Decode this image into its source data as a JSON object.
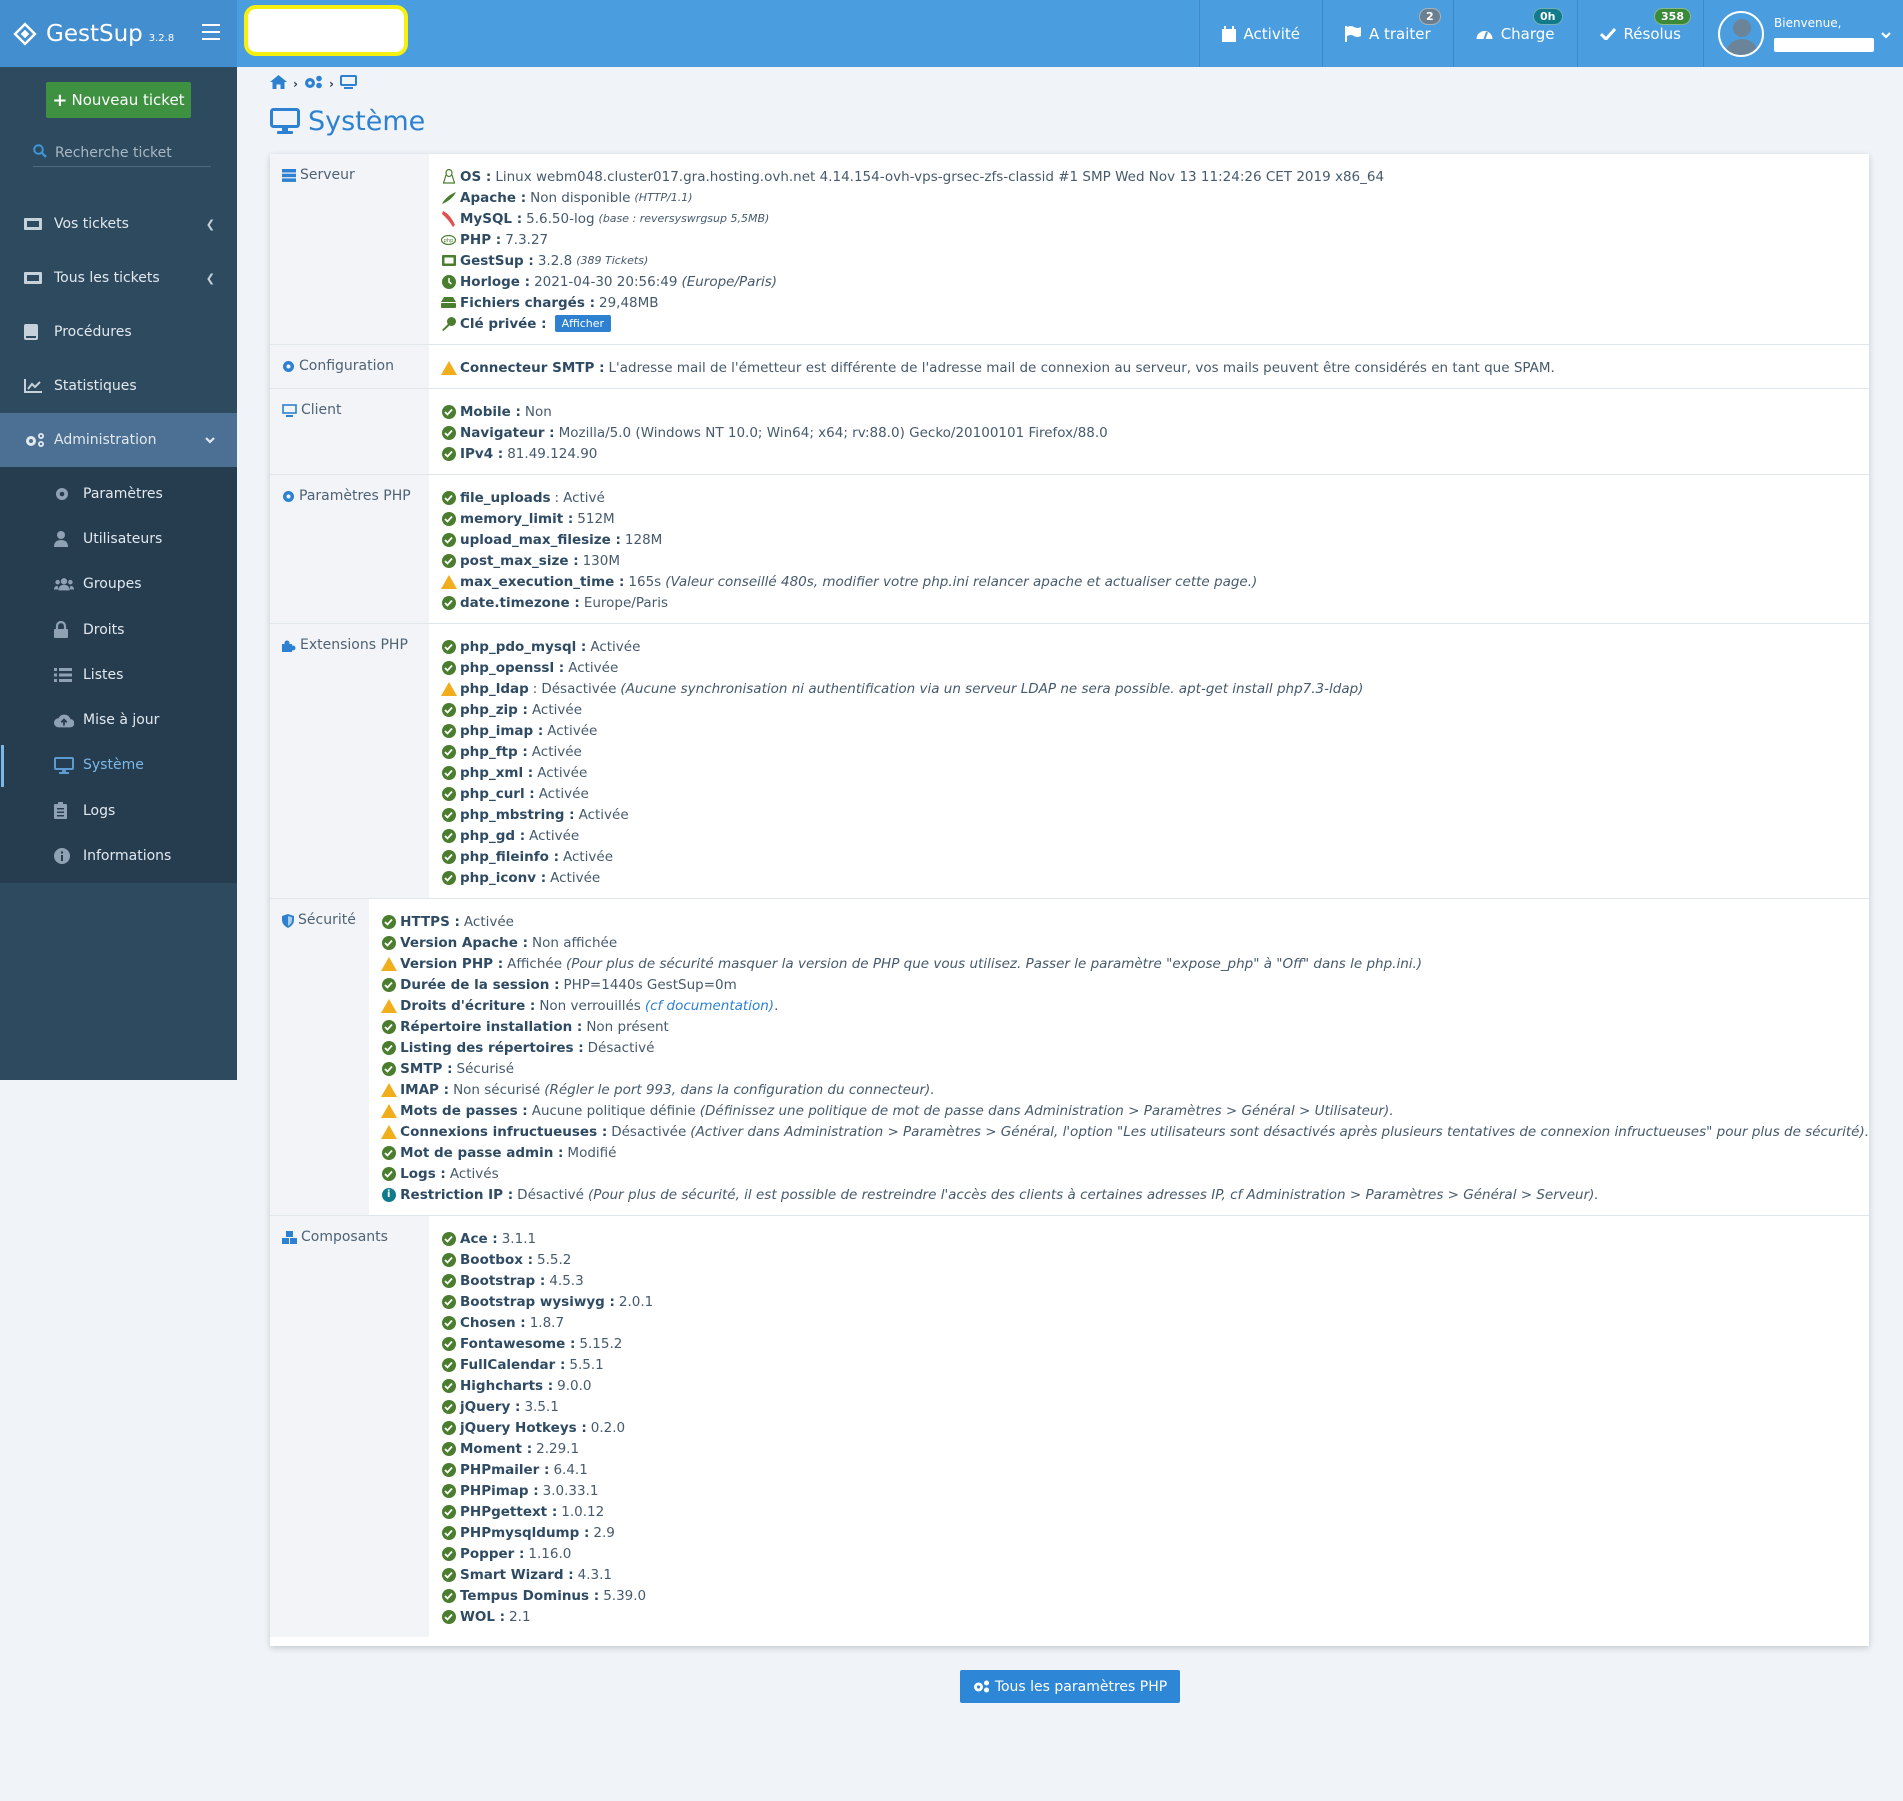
{
  "header": {
    "app_name": "GestSup",
    "app_version": "3.2.8",
    "nav": [
      {
        "label": "Activité",
        "icon": "calendar-icon"
      },
      {
        "label": "A traiter",
        "icon": "flag-icon",
        "badge": "2"
      },
      {
        "label": "Charge",
        "icon": "gauge-icon",
        "badge": "0h"
      },
      {
        "label": "Résolus",
        "icon": "check-icon",
        "badge": "358"
      }
    ],
    "user": {
      "welcome": "Bienvenue,"
    }
  },
  "sidebar": {
    "new_ticket_label": "Nouveau ticket",
    "search_placeholder": "Recherche ticket",
    "items": [
      {
        "label": "Vos tickets",
        "icon": "ticket-icon"
      },
      {
        "label": "Tous les tickets",
        "icon": "ticket-icon"
      },
      {
        "label": "Procédures",
        "icon": "book-icon"
      },
      {
        "label": "Statistiques",
        "icon": "chart-line-icon"
      },
      {
        "label": "Administration",
        "icon": "cogs-icon"
      }
    ],
    "subitems": [
      {
        "label": "Paramètres",
        "icon": "cog-icon"
      },
      {
        "label": "Utilisateurs",
        "icon": "user-icon"
      },
      {
        "label": "Groupes",
        "icon": "users-icon"
      },
      {
        "label": "Droits",
        "icon": "lock-icon"
      },
      {
        "label": "Listes",
        "icon": "list-icon"
      },
      {
        "label": "Mise à jour",
        "icon": "cloud-upload-icon"
      },
      {
        "label": "Système",
        "icon": "desktop-icon"
      },
      {
        "label": "Logs",
        "icon": "clipboard-list-icon"
      },
      {
        "label": "Informations",
        "icon": "info-circle-icon"
      }
    ]
  },
  "page": {
    "title": "Système",
    "breadcrumb": [
      "home-icon",
      "cogs-icon",
      "desktop-icon"
    ]
  },
  "sections": {
    "server": {
      "label": "Serveur",
      "rows": [
        {
          "key": "OS :",
          "value": "Linux webm048.cluster017.gra.hosting.ovh.net 4.14.154-ovh-vps-grsec-zfs-classid #1 SMP Wed Nov 13 11:24:26 CET 2019 x86_64"
        },
        {
          "key": "Apache :",
          "value": "Non disponible",
          "note": "(HTTP/1.1)"
        },
        {
          "key": "MySQL :",
          "value": "5.6.50-log",
          "note": "(base : reversyswrgsup 5,5MB)"
        },
        {
          "key": "PHP :",
          "value": "7.3.27"
        },
        {
          "key": "GestSup :",
          "value": "3.2.8",
          "note": "(389 Tickets)"
        },
        {
          "key": "Horloge :",
          "value": "2021-04-30 20:56:49",
          "note": "(Europe/Paris)"
        },
        {
          "key": "Fichiers chargés :",
          "value": "29,48MB"
        },
        {
          "key": "Clé privée :",
          "button": "Afficher"
        }
      ]
    },
    "configuration": {
      "label": "Configuration",
      "rows": [
        {
          "status": "warn",
          "key": "Connecteur SMTP :",
          "value": "L'adresse mail de l'émetteur est différente de l'adresse mail de connexion au serveur, vos mails peuvent être considérés en tant que SPAM."
        }
      ]
    },
    "client": {
      "label": "Client",
      "rows": [
        {
          "status": "ok",
          "key": "Mobile :",
          "value": "Non"
        },
        {
          "status": "ok",
          "key": "Navigateur :",
          "value": "Mozilla/5.0 (Windows NT 10.0; Win64; x64; rv:88.0) Gecko/20100101 Firefox/88.0"
        },
        {
          "status": "ok",
          "key": "IPv4 :",
          "value": "81.49.124.90"
        }
      ]
    },
    "php_params": {
      "label": "Paramètres PHP",
      "rows": [
        {
          "status": "ok",
          "key": "file_uploads",
          "sep": ":",
          "value": "Activé"
        },
        {
          "status": "ok",
          "key": "memory_limit :",
          "value": "512M"
        },
        {
          "status": "ok",
          "key": "upload_max_filesize :",
          "value": "128M"
        },
        {
          "status": "ok",
          "key": "post_max_size :",
          "value": "130M"
        },
        {
          "status": "warn",
          "key": "max_execution_time :",
          "value": "165s",
          "note": "(Valeur conseillé 480s, modifier votre php.ini relancer apache et actualiser cette page.)"
        },
        {
          "status": "ok",
          "key": "date.timezone :",
          "value": "Europe/Paris"
        }
      ]
    },
    "php_extensions": {
      "label": "Extensions PHP",
      "rows": [
        {
          "status": "ok",
          "key": "php_pdo_mysql :",
          "value": "Activée"
        },
        {
          "status": "ok",
          "key": "php_openssl :",
          "value": "Activée"
        },
        {
          "status": "warn",
          "key": "php_ldap",
          "sep": ":",
          "value": "Désactivée",
          "note": "(Aucune synchronisation ni authentification via un serveur LDAP ne sera possible. apt-get install php7.3-ldap)"
        },
        {
          "status": "ok",
          "key": "php_zip :",
          "value": "Activée"
        },
        {
          "status": "ok",
          "key": "php_imap :",
          "value": "Activée"
        },
        {
          "status": "ok",
          "key": "php_ftp :",
          "value": "Activée"
        },
        {
          "status": "ok",
          "key": "php_xml :",
          "value": "Activée"
        },
        {
          "status": "ok",
          "key": "php_curl :",
          "value": "Activée"
        },
        {
          "status": "ok",
          "key": "php_mbstring :",
          "value": "Activée"
        },
        {
          "status": "ok",
          "key": "php_gd :",
          "value": "Activée"
        },
        {
          "status": "ok",
          "key": "php_fileinfo :",
          "value": "Activée"
        },
        {
          "status": "ok",
          "key": "php_iconv :",
          "value": "Activée"
        }
      ]
    },
    "security": {
      "label": "Sécurité",
      "rows": [
        {
          "status": "ok",
          "key": "HTTPS :",
          "value": "Activée"
        },
        {
          "status": "ok",
          "key": "Version Apache :",
          "value": "Non affichée"
        },
        {
          "status": "warn",
          "key": "Version PHP :",
          "value": "Affichée",
          "note": "(Pour plus de sécurité masquer la version de PHP que vous utilisez. Passer le paramètre \"expose_php\" à \"Off\" dans le php.ini.)"
        },
        {
          "status": "ok",
          "key": "Durée de la session :",
          "value": "PHP=1440s GestSup=0m"
        },
        {
          "status": "warn",
          "key": "Droits d'écriture :",
          "value": "Non verrouillés",
          "link": "(cf documentation)",
          "tail": "."
        },
        {
          "status": "ok",
          "key": "Répertoire installation :",
          "value": "Non présent"
        },
        {
          "status": "ok",
          "key": "Listing des répertoires :",
          "value": "Désactivé"
        },
        {
          "status": "ok",
          "key": "SMTP :",
          "value": "Sécurisé"
        },
        {
          "status": "warn",
          "key": "IMAP :",
          "value": "Non sécurisé",
          "note": "(Régler le port 993, dans la configuration du connecteur)."
        },
        {
          "status": "warn",
          "key": "Mots de passes :",
          "value": "Aucune politique définie",
          "note": "(Définissez une politique de mot de passe dans Administration > Paramètres > Général > Utilisateur)."
        },
        {
          "status": "warn",
          "key": "Connexions infructueuses :",
          "value": "Désactivée",
          "note": "(Activer dans Administration > Paramètres > Général, l'option \"Les utilisateurs sont désactivés après plusieurs tentatives de connexion infructueuses\" pour plus de sécurité)."
        },
        {
          "status": "ok",
          "key": "Mot de passe admin :",
          "value": "Modifié"
        },
        {
          "status": "ok",
          "key": "Logs :",
          "value": "Activés"
        },
        {
          "status": "info",
          "key": "Restriction IP :",
          "value": "Désactivé",
          "note": "(Pour plus de sécurité, il est possible de restreindre l'accès des clients à certaines adresses IP, cf Administration > Paramètres > Général > Serveur)."
        }
      ]
    },
    "components": {
      "label": "Composants",
      "rows": [
        {
          "status": "ok",
          "key": "Ace :",
          "value": "3.1.1"
        },
        {
          "status": "ok",
          "key": "Bootbox :",
          "value": "5.5.2"
        },
        {
          "status": "ok",
          "key": "Bootstrap :",
          "value": "4.5.3"
        },
        {
          "status": "ok",
          "key": "Bootstrap wysiwyg :",
          "value": "2.0.1"
        },
        {
          "status": "ok",
          "key": "Chosen :",
          "value": "1.8.7"
        },
        {
          "status": "ok",
          "key": "Fontawesome :",
          "value": "5.15.2"
        },
        {
          "status": "ok",
          "key": "FullCalendar :",
          "value": "5.5.1"
        },
        {
          "status": "ok",
          "key": "Highcharts :",
          "value": "9.0.0"
        },
        {
          "status": "ok",
          "key": "jQuery :",
          "value": "3.5.1"
        },
        {
          "status": "ok",
          "key": "jQuery Hotkeys :",
          "value": "0.2.0"
        },
        {
          "status": "ok",
          "key": "Moment :",
          "value": "2.29.1"
        },
        {
          "status": "ok",
          "key": "PHPmailer :",
          "value": "6.4.1"
        },
        {
          "status": "ok",
          "key": "PHPimap :",
          "value": "3.0.33.1"
        },
        {
          "status": "ok",
          "key": "PHPgettext :",
          "value": "1.0.12"
        },
        {
          "status": "ok",
          "key": "PHPmysqldump :",
          "value": "2.9"
        },
        {
          "status": "ok",
          "key": "Popper :",
          "value": "1.16.0"
        },
        {
          "status": "ok",
          "key": "Smart Wizard :",
          "value": "4.3.1"
        },
        {
          "status": "ok",
          "key": "Tempus Dominus :",
          "value": "5.39.0"
        },
        {
          "status": "ok",
          "key": "WOL :",
          "value": "2.1"
        }
      ]
    }
  },
  "footer_button": {
    "label": "Tous les paramètres PHP"
  },
  "colors": {
    "header": "#4a9edf",
    "sidebar": "#2e4a5f",
    "accent": "#2d81d0",
    "ok": "#4a7d2e",
    "warn": "#f0ad1c",
    "new_ticket": "#3d9140"
  }
}
